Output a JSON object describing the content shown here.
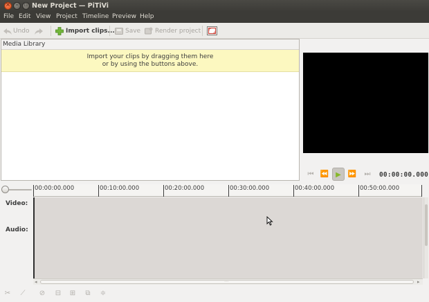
{
  "window": {
    "title": "New Project — PiTiVi"
  },
  "menu": {
    "items": [
      "File",
      "Edit",
      "View",
      "Project",
      "Timeline",
      "Preview",
      "Help"
    ]
  },
  "toolbar": {
    "undo_label": "Undo",
    "import_label": "Import clips...",
    "save_label": "Save",
    "render_label": "Render project"
  },
  "library": {
    "title": "Media Library",
    "info_line1": "Import your clips by dragging them here",
    "info_line2": "or by using the buttons above."
  },
  "viewer": {
    "timecode": "00:00:00.000"
  },
  "ruler": {
    "labels": [
      "00:00:00.000",
      "00:10:00.000",
      "00:20:00.000",
      "00:30:00.000",
      "00:40:00.000",
      "00:50:00.000"
    ]
  },
  "tracks": {
    "video_label": "Video:",
    "audio_label": "Audio:"
  },
  "colors": {
    "titlebar": "#3c3b37",
    "info_bar": "#fcf8c0",
    "timeline_bg": "#dcd8d5",
    "viewer_bg": "#000000",
    "play_accent": "#86b82a"
  },
  "icons": {
    "undo": "undo-arrow-icon",
    "redo": "redo-arrow-icon",
    "import": "green-plus-icon",
    "save": "save-icon",
    "render": "render-icon",
    "fullscreen": "fullscreen-icon"
  }
}
